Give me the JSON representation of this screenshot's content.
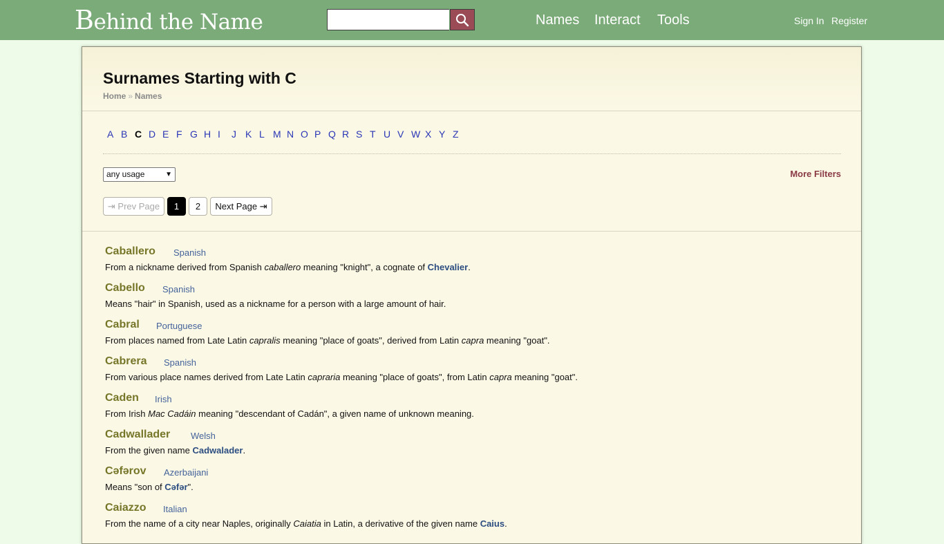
{
  "site": {
    "logo_cap": "B",
    "logo_rest": "ehind the Name",
    "search": {
      "value": "",
      "placeholder": ""
    },
    "nav": [
      "Names",
      "Interact",
      "Tools"
    ],
    "account": {
      "sign_in": "Sign In",
      "register": "Register"
    }
  },
  "page": {
    "title": "Surnames Starting with C",
    "breadcrumb": [
      "Home",
      "Names"
    ],
    "breadcrumb_sep": "»",
    "letters": [
      "A",
      "B",
      "C",
      "D",
      "E",
      "F",
      "G",
      "H",
      "I",
      "J",
      "K",
      "L",
      "M",
      "N",
      "O",
      "P",
      "Q",
      "R",
      "S",
      "T",
      "U",
      "V",
      "W",
      "X",
      "Y",
      "Z"
    ],
    "active_letter": "C",
    "usage_filter": {
      "selected": "any usage"
    },
    "more_filters": "More Filters",
    "pager": {
      "prev": "⇥ Prev Page",
      "pages": [
        "1",
        "2"
      ],
      "current": "1",
      "next": "Next Page ⇥"
    }
  },
  "entries": [
    {
      "name": "Caballero",
      "usage": "Spanish",
      "desc": [
        {
          "t": "From a nickname derived from Spanish "
        },
        {
          "t": "caballero",
          "i": true
        },
        {
          "t": " meaning \"knight\", a cognate of "
        },
        {
          "t": "Chevalier",
          "l": true
        },
        {
          "t": "."
        }
      ]
    },
    {
      "name": "Cabello",
      "usage": "Spanish",
      "desc": [
        {
          "t": "Means \"hair\" in Spanish, used as a nickname for a person with a large amount of hair."
        }
      ]
    },
    {
      "name": "Cabral",
      "usage": "Portuguese",
      "desc": [
        {
          "t": "From places named from Late Latin "
        },
        {
          "t": "capralis",
          "i": true
        },
        {
          "t": " meaning \"place of goats\", derived from Latin "
        },
        {
          "t": "capra",
          "i": true
        },
        {
          "t": " meaning \"goat\"."
        }
      ]
    },
    {
      "name": "Cabrera",
      "usage": "Spanish",
      "desc": [
        {
          "t": "From various place names derived from Late Latin "
        },
        {
          "t": "capraria",
          "i": true
        },
        {
          "t": " meaning \"place of goats\", from Latin "
        },
        {
          "t": "capra",
          "i": true
        },
        {
          "t": " meaning \"goat\"."
        }
      ]
    },
    {
      "name": "Caden",
      "usage": "Irish",
      "desc": [
        {
          "t": "From Irish "
        },
        {
          "t": "Mac Cadáin",
          "i": true
        },
        {
          "t": " meaning \"descendant of Cadán\", a given name of unknown meaning."
        }
      ]
    },
    {
      "name": "Cadwallader",
      "usage": "Welsh",
      "desc": [
        {
          "t": "From the given name "
        },
        {
          "t": "Cadwalader",
          "l": true
        },
        {
          "t": "."
        }
      ]
    },
    {
      "name": "Cəfərov",
      "usage": "Azerbaijani",
      "desc": [
        {
          "t": "Means \"son of "
        },
        {
          "t": "Cəfər",
          "l": true
        },
        {
          "t": "\"."
        }
      ]
    },
    {
      "name": "Caiazzo",
      "usage": "Italian",
      "desc": [
        {
          "t": "From the name of a city near Naples, originally "
        },
        {
          "t": "Caiatia",
          "i": true
        },
        {
          "t": " in Latin, a derivative of the given name "
        },
        {
          "t": "Caius",
          "l": true
        },
        {
          "t": "."
        }
      ]
    }
  ]
}
